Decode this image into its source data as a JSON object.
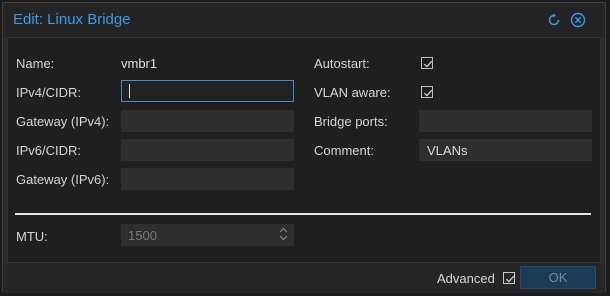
{
  "window": {
    "title": "Edit: Linux Bridge",
    "icons": [
      "reset-icon",
      "close-icon"
    ]
  },
  "form": {
    "left": [
      {
        "label": "Name:",
        "value": "vmbr1"
      },
      {
        "label": "IPv4/CIDR:",
        "value": "",
        "focused": true
      },
      {
        "label": "Gateway (IPv4):",
        "value": ""
      },
      {
        "label": "IPv6/CIDR:",
        "value": ""
      },
      {
        "label": "Gateway (IPv6):",
        "value": ""
      }
    ],
    "right": [
      {
        "label": "Autostart:",
        "checked": true
      },
      {
        "label": "VLAN aware:",
        "checked": true
      },
      {
        "label": "Bridge ports:",
        "value": ""
      },
      {
        "label": "Comment:",
        "value": "VLANs"
      }
    ],
    "mtu": {
      "label": "MTU:",
      "placeholder": "1500"
    }
  },
  "footer": {
    "advanced_label": "Advanced",
    "advanced_checked": true,
    "ok_label": "OK"
  },
  "colors": {
    "accent": "#3a9be8",
    "background": "#1f1f1f",
    "ok_button": "#1d3b55"
  }
}
